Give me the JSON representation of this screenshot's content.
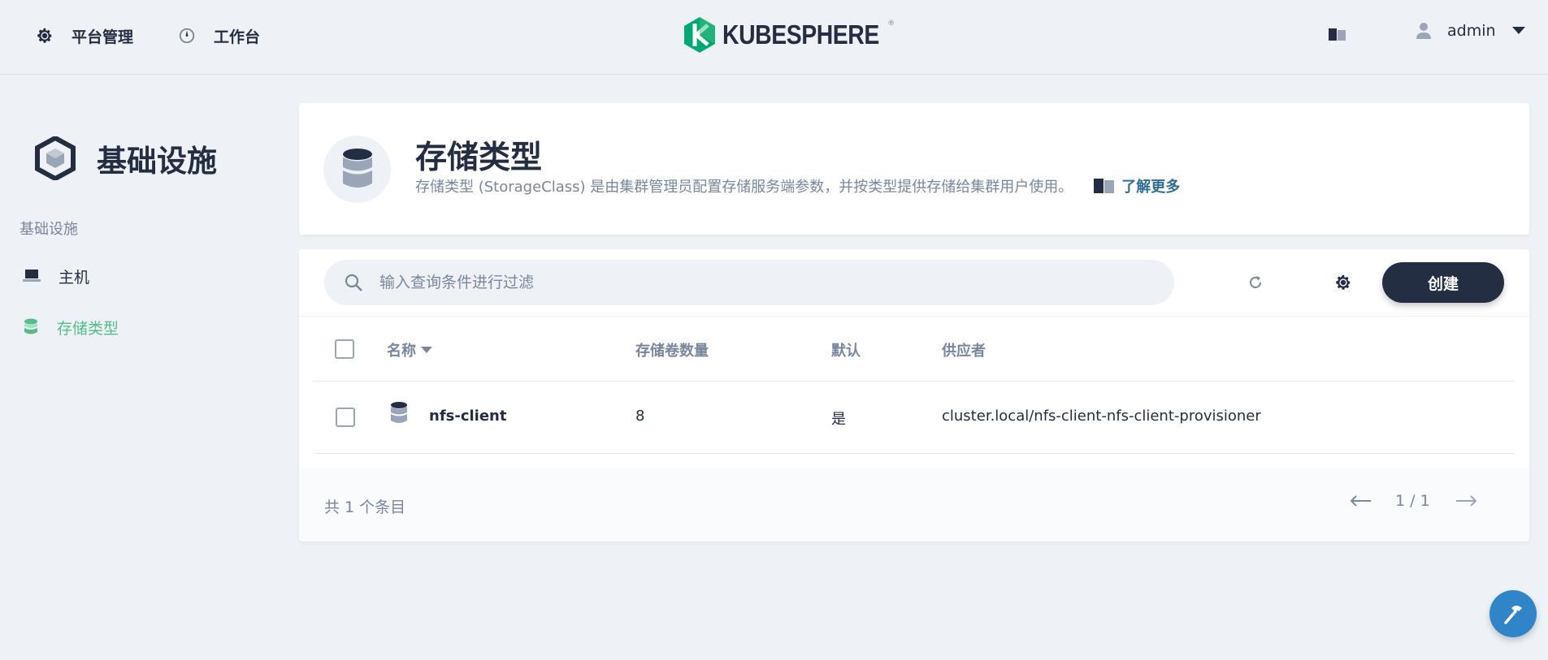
{
  "header": {
    "nav": [
      {
        "label": "平台管理",
        "icon": "gear-icon"
      },
      {
        "label": "工作台",
        "icon": "compass-icon"
      }
    ],
    "logo_text": "KUBESPHERE",
    "logo_mark": "®",
    "user": {
      "name": "admin"
    }
  },
  "sidebar": {
    "title": "基础设施",
    "group": "基础设施",
    "items": [
      {
        "label": "主机",
        "icon": "laptop-icon",
        "active": false
      },
      {
        "label": "存储类型",
        "icon": "database-icon",
        "active": true
      }
    ]
  },
  "banner": {
    "title": "存储类型",
    "description": "存储类型 (StorageClass) 是由集群管理员配置存储服务端参数，并按类型提供存储给集群用户使用。",
    "learn_more": "了解更多"
  },
  "toolbar": {
    "search_placeholder": "输入查询条件进行过滤",
    "create_label": "创建"
  },
  "table": {
    "columns": [
      "名称",
      "存储卷数量",
      "默认",
      "供应者"
    ],
    "rows": [
      {
        "name": "nfs-client",
        "volumes": "8",
        "default": "是",
        "provisioner": "cluster.local/nfs-client-nfs-client-provisioner"
      }
    ]
  },
  "footer": {
    "total": "共 1 个条目",
    "page": "1 / 1"
  },
  "colors": {
    "primary": "#242e42",
    "muted": "#79879c",
    "accent_green": "#55bc8a",
    "link": "#326e93",
    "background": "#eef2f6"
  }
}
